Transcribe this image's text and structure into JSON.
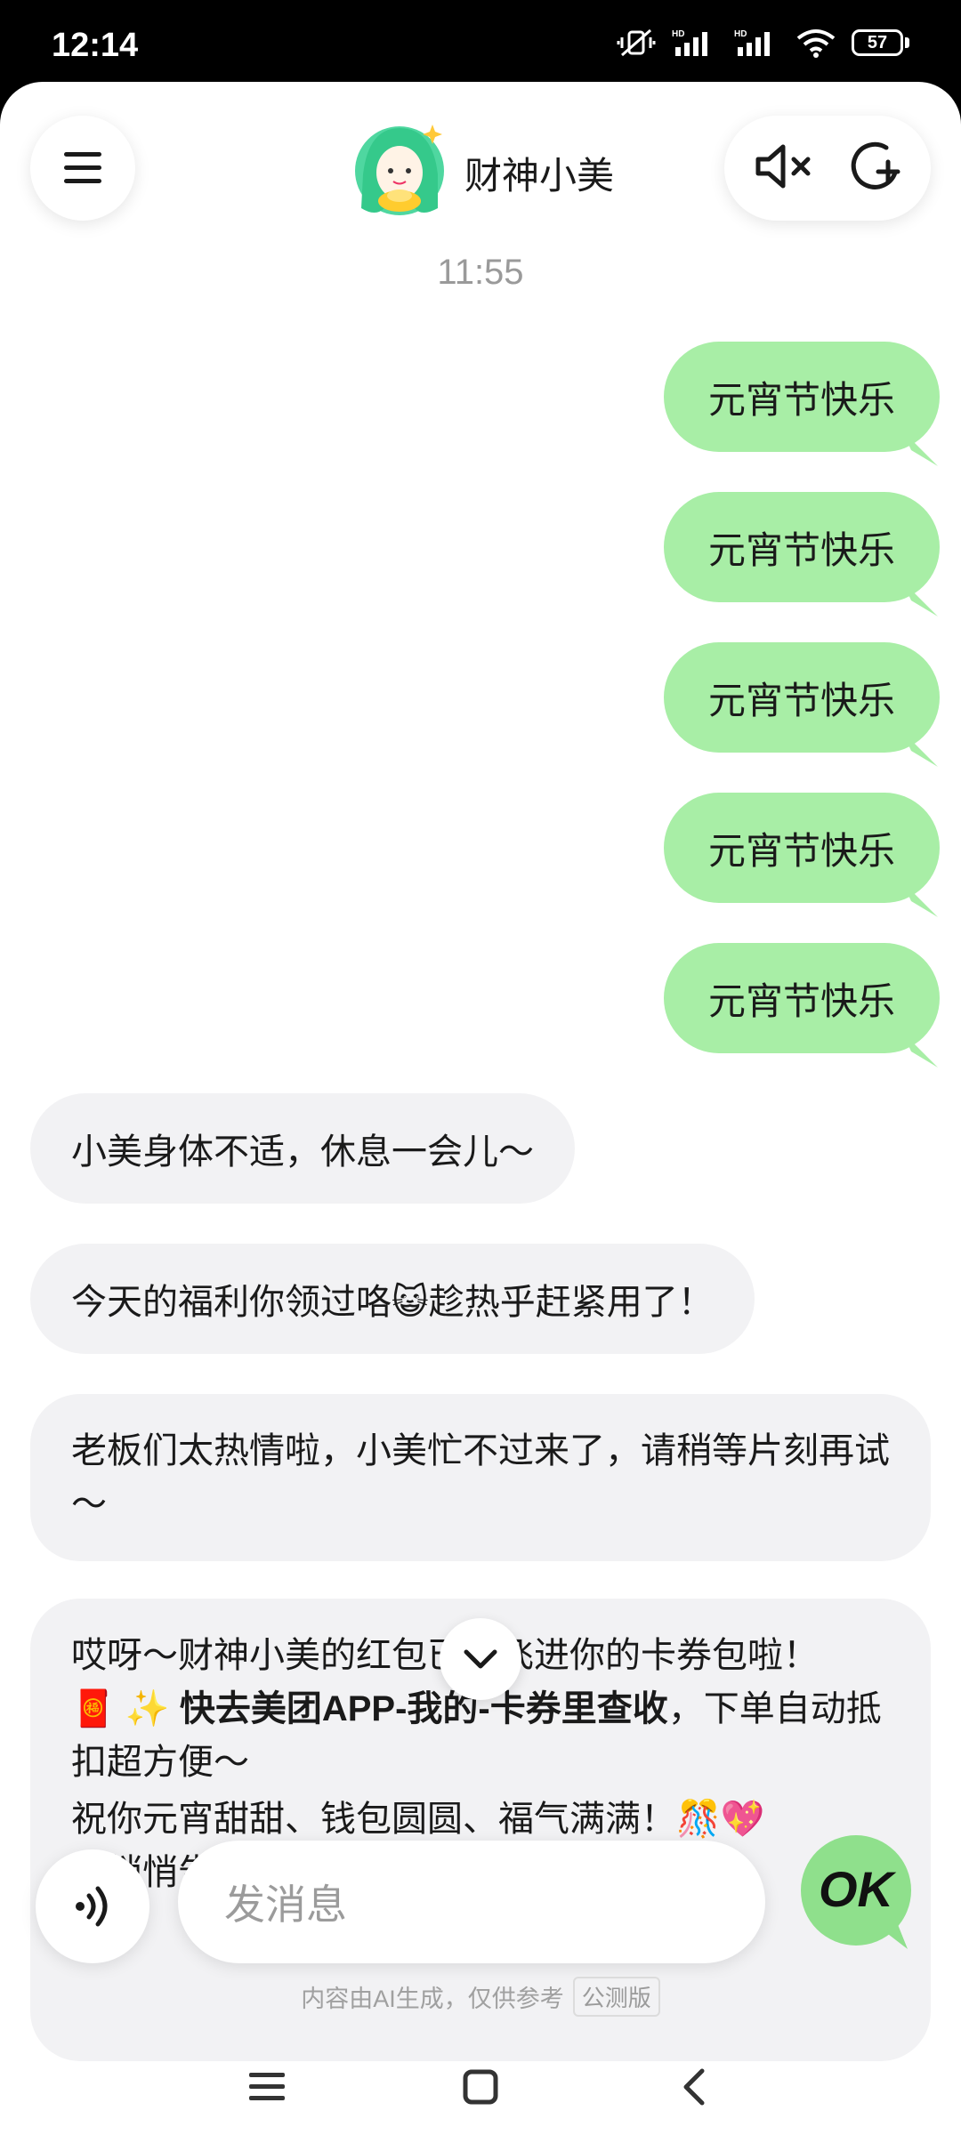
{
  "status_bar": {
    "time": "12:14",
    "battery": "57"
  },
  "header": {
    "title": "财神小美"
  },
  "chat": {
    "timestamp": "11:55",
    "user_messages": [
      "元宵节快乐",
      "元宵节快乐",
      "元宵节快乐",
      "元宵节快乐",
      "元宵节快乐"
    ],
    "bot_messages": [
      "小美身体不适，休息一会儿～",
      "今天的福利你领过咯😺趁热乎赶紧用了！",
      "老板们太热情啦，小美忙不过来了，请稍等片刻再试～"
    ],
    "last_message": {
      "line1": "哎呀～财神小美的红包已经飞进你的卡券包啦！",
      "line2_prefix": "🧧 ✨ ",
      "line2_bold": "快去美团APP-我的-卡券里查收",
      "line2_suffix": "，下单自动抵扣超方便～",
      "line3": "祝你元宵甜甜、钱包圆圆、福气满满！🎊💖",
      "line4": "小悄悄告诉你，小美会一直陪着你"
    }
  },
  "input": {
    "placeholder": "发消息",
    "send_label": "OK"
  },
  "footer": {
    "disclaimer": "内容由AI生成，仅供参考",
    "beta_tag": "公测版"
  },
  "colors": {
    "user_bubble": "#a8eea6",
    "bot_bubble": "#f2f2f4",
    "accent": "#8fe08c"
  }
}
